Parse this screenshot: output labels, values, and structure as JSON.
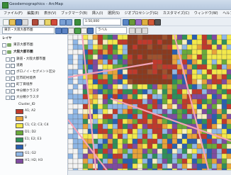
{
  "window": {
    "title": "Geodemographics  - ArcMap"
  },
  "menu": [
    "ファイル(F)",
    "編集(E)",
    "表示(V)",
    "ブックマーク(B)",
    "挿入(I)",
    "選択(S)",
    "ジオプロセシング(G)",
    "カスタマイズ(C)",
    "ウィンドウ(W)",
    "ヘルプ(H)"
  ],
  "toolbar": {
    "scale": "1:50,000",
    "layer_combo": "東京・大阪大都市圏",
    "label_combo": "ラベル"
  },
  "toc": {
    "group_title": "レイヤ",
    "layers": [
      {
        "label": "東京大都市圏",
        "level": 0
      },
      {
        "label": "大阪大都市圏",
        "level": 0
      },
      {
        "label": "鉄道・大阪大都市圏",
        "level": 1
      },
      {
        "label": "道路",
        "level": 1
      },
      {
        "label": "ボロノイ・セグメント区分",
        "level": 1
      },
      {
        "label": "区市町村境界",
        "level": 1
      },
      {
        "label": "町丁目境界",
        "level": 1
      },
      {
        "label": "中分類クラスタ",
        "level": 1
      },
      {
        "label": "大分類クラスタ",
        "level": 1
      },
      {
        "label": "大分類クラスタ",
        "level": 1
      }
    ],
    "legend_header": "Cluster_ID",
    "legend": [
      {
        "label": "A1; A2",
        "color": "#c0392b"
      },
      {
        "label": "B",
        "color": "#e8a33a"
      },
      {
        "label": "C1; C2; C3; C4",
        "color": "#f3e84b"
      },
      {
        "label": "D1; D2",
        "color": "#6aaa3a"
      },
      {
        "label": "E1; E2; E3",
        "color": "#2f8f5a"
      },
      {
        "label": "F",
        "color": "#2a5fb0"
      },
      {
        "label": "G1; G2",
        "color": "#8fb7e6"
      },
      {
        "label": "H1; H2; H3",
        "color": "#7f4ba0"
      }
    ]
  },
  "icons": [
    "add-data-icon",
    "zoom-in-icon",
    "zoom-out-icon",
    "pan-icon",
    "identify-icon",
    "select-icon"
  ]
}
